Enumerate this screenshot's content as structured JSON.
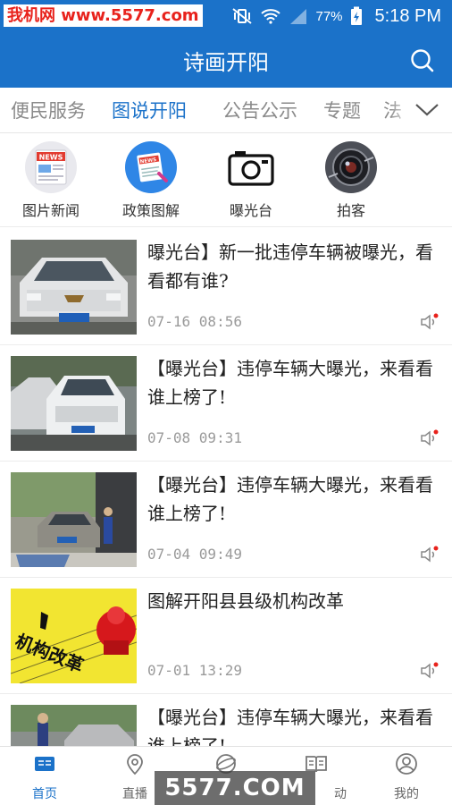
{
  "watermark_top": "我机网 www.5577.com",
  "watermark_bottom": "5577.COM",
  "status": {
    "battery": "77%",
    "time": "5:18 PM"
  },
  "header": {
    "title": "诗画开阳"
  },
  "tabs": [
    "便民服务",
    "图说开阳",
    "公告公示",
    "专题",
    "法"
  ],
  "active_tab": 1,
  "channels": [
    {
      "label": "图片新闻",
      "icon": "news-icon"
    },
    {
      "label": "政策图解",
      "icon": "policy-news-icon"
    },
    {
      "label": "曝光台",
      "icon": "camera-icon"
    },
    {
      "label": "拍客",
      "icon": "lens-icon"
    }
  ],
  "news": [
    {
      "title": "曝光台】新一批违停车辆被曝光，看看都有谁?",
      "date": "07-16  08:56"
    },
    {
      "title": "【曝光台】违停车辆大曝光，来看看谁上榜了!",
      "date": "07-08  09:31"
    },
    {
      "title": "【曝光台】违停车辆大曝光，来看看谁上榜了!",
      "date": "07-04  09:49"
    },
    {
      "title": "图解开阳县县级机构改革",
      "date": "07-01  13:29",
      "thumb_text": "机构改革"
    },
    {
      "title": "【曝光台】违停车辆大曝光，来看看谁上榜了!",
      "date": ""
    }
  ],
  "bottom_nav": [
    {
      "label": "首页",
      "icon": "home-icon"
    },
    {
      "label": "直播",
      "icon": "location-icon"
    },
    {
      "label": "",
      "icon": "orbit-icon"
    },
    {
      "label": "动",
      "icon": "book-icon"
    },
    {
      "label": "我的",
      "icon": "user-icon"
    }
  ],
  "colors": {
    "brand": "#1b72c9",
    "accent_dot": "#e8221c"
  }
}
